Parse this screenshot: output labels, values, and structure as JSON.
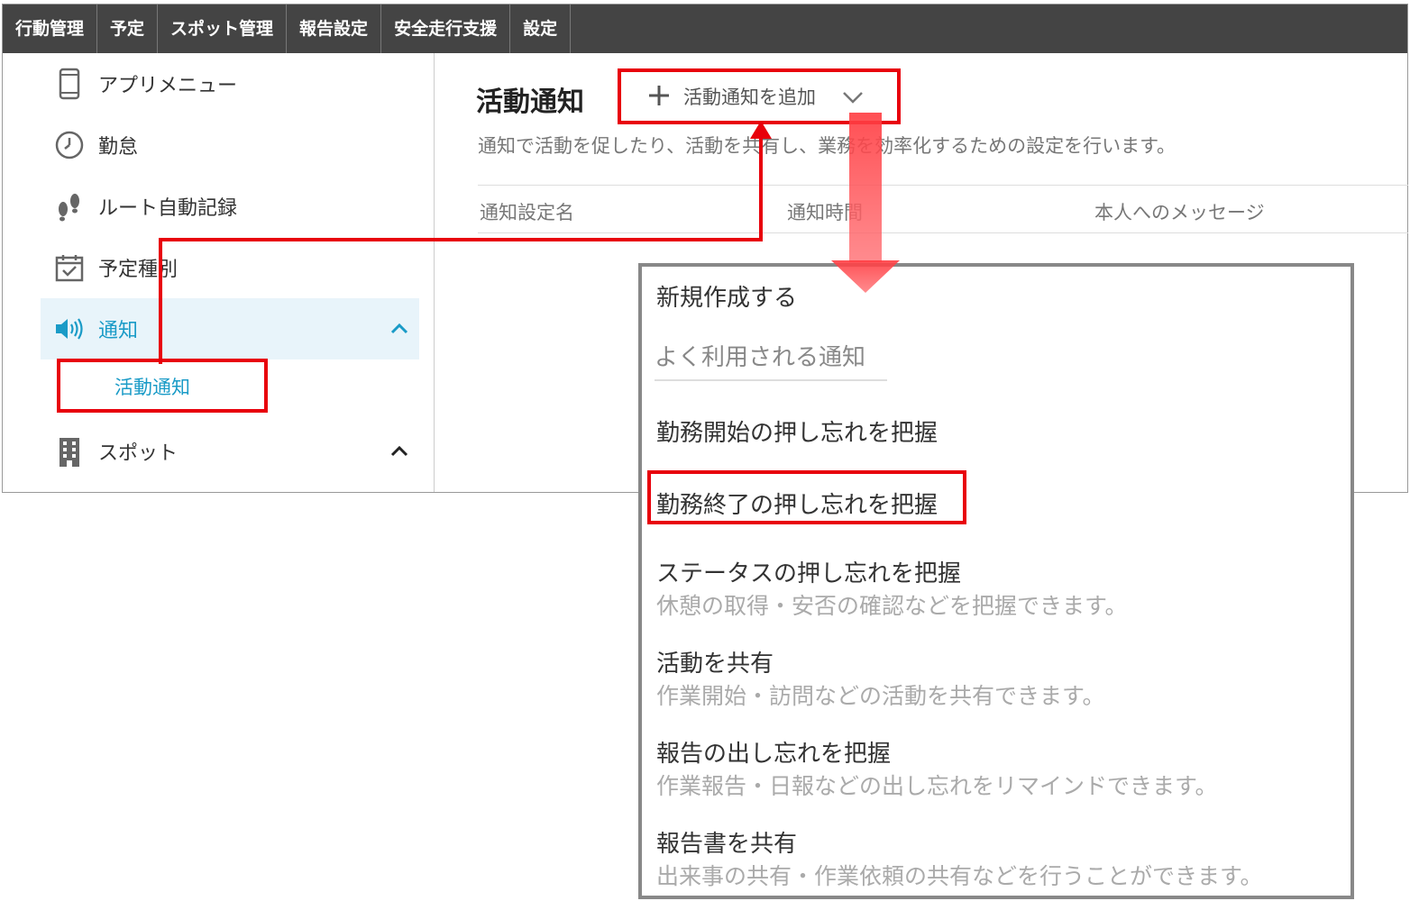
{
  "topnav": {
    "items": [
      "行動管理",
      "予定",
      "スポット管理",
      "報告設定",
      "安全走行支援",
      "設定"
    ]
  },
  "sidebar": {
    "items": [
      {
        "label": "アプリメニュー",
        "icon": "phone-icon"
      },
      {
        "label": "勤怠",
        "icon": "clock-icon"
      },
      {
        "label": "ルート自動記録",
        "icon": "footprints-icon"
      },
      {
        "label": "予定種別",
        "icon": "calendar-check-icon"
      },
      {
        "label": "通知",
        "icon": "speaker-icon"
      },
      {
        "label": "スポット",
        "icon": "building-icon"
      }
    ],
    "sub_item": "活動通知"
  },
  "main": {
    "title": "活動通知",
    "add_button": "活動通知を追加",
    "description": "通知で活動を促したり、活動を共有し、業務を効率化するための設定を行います。",
    "columns": [
      "通知設定名",
      "通知時間",
      "本人へのメッセージ"
    ]
  },
  "dropdown": {
    "new": "新規作成する",
    "heading": "よく利用される通知",
    "options": [
      {
        "label": "勤務開始の押し忘れを把握",
        "desc": ""
      },
      {
        "label": "勤務終了の押し忘れを把握",
        "desc": ""
      },
      {
        "label": "ステータスの押し忘れを把握",
        "desc": "休憩の取得・安否の確認などを把握できます。"
      },
      {
        "label": "活動を共有",
        "desc": "作業開始・訪問などの活動を共有できます。"
      },
      {
        "label": "報告の出し忘れを把握",
        "desc": "作業報告・日報などの出し忘れをリマインドできます。"
      },
      {
        "label": "報告書を共有",
        "desc": "出来事の共有・作業依頼の共有などを行うことができます。"
      }
    ]
  },
  "colors": {
    "nav_bg": "#444444",
    "accent": "#1a9bc7",
    "highlight_red": "#e8000b",
    "arrow_pink": "#ff5a5f"
  }
}
